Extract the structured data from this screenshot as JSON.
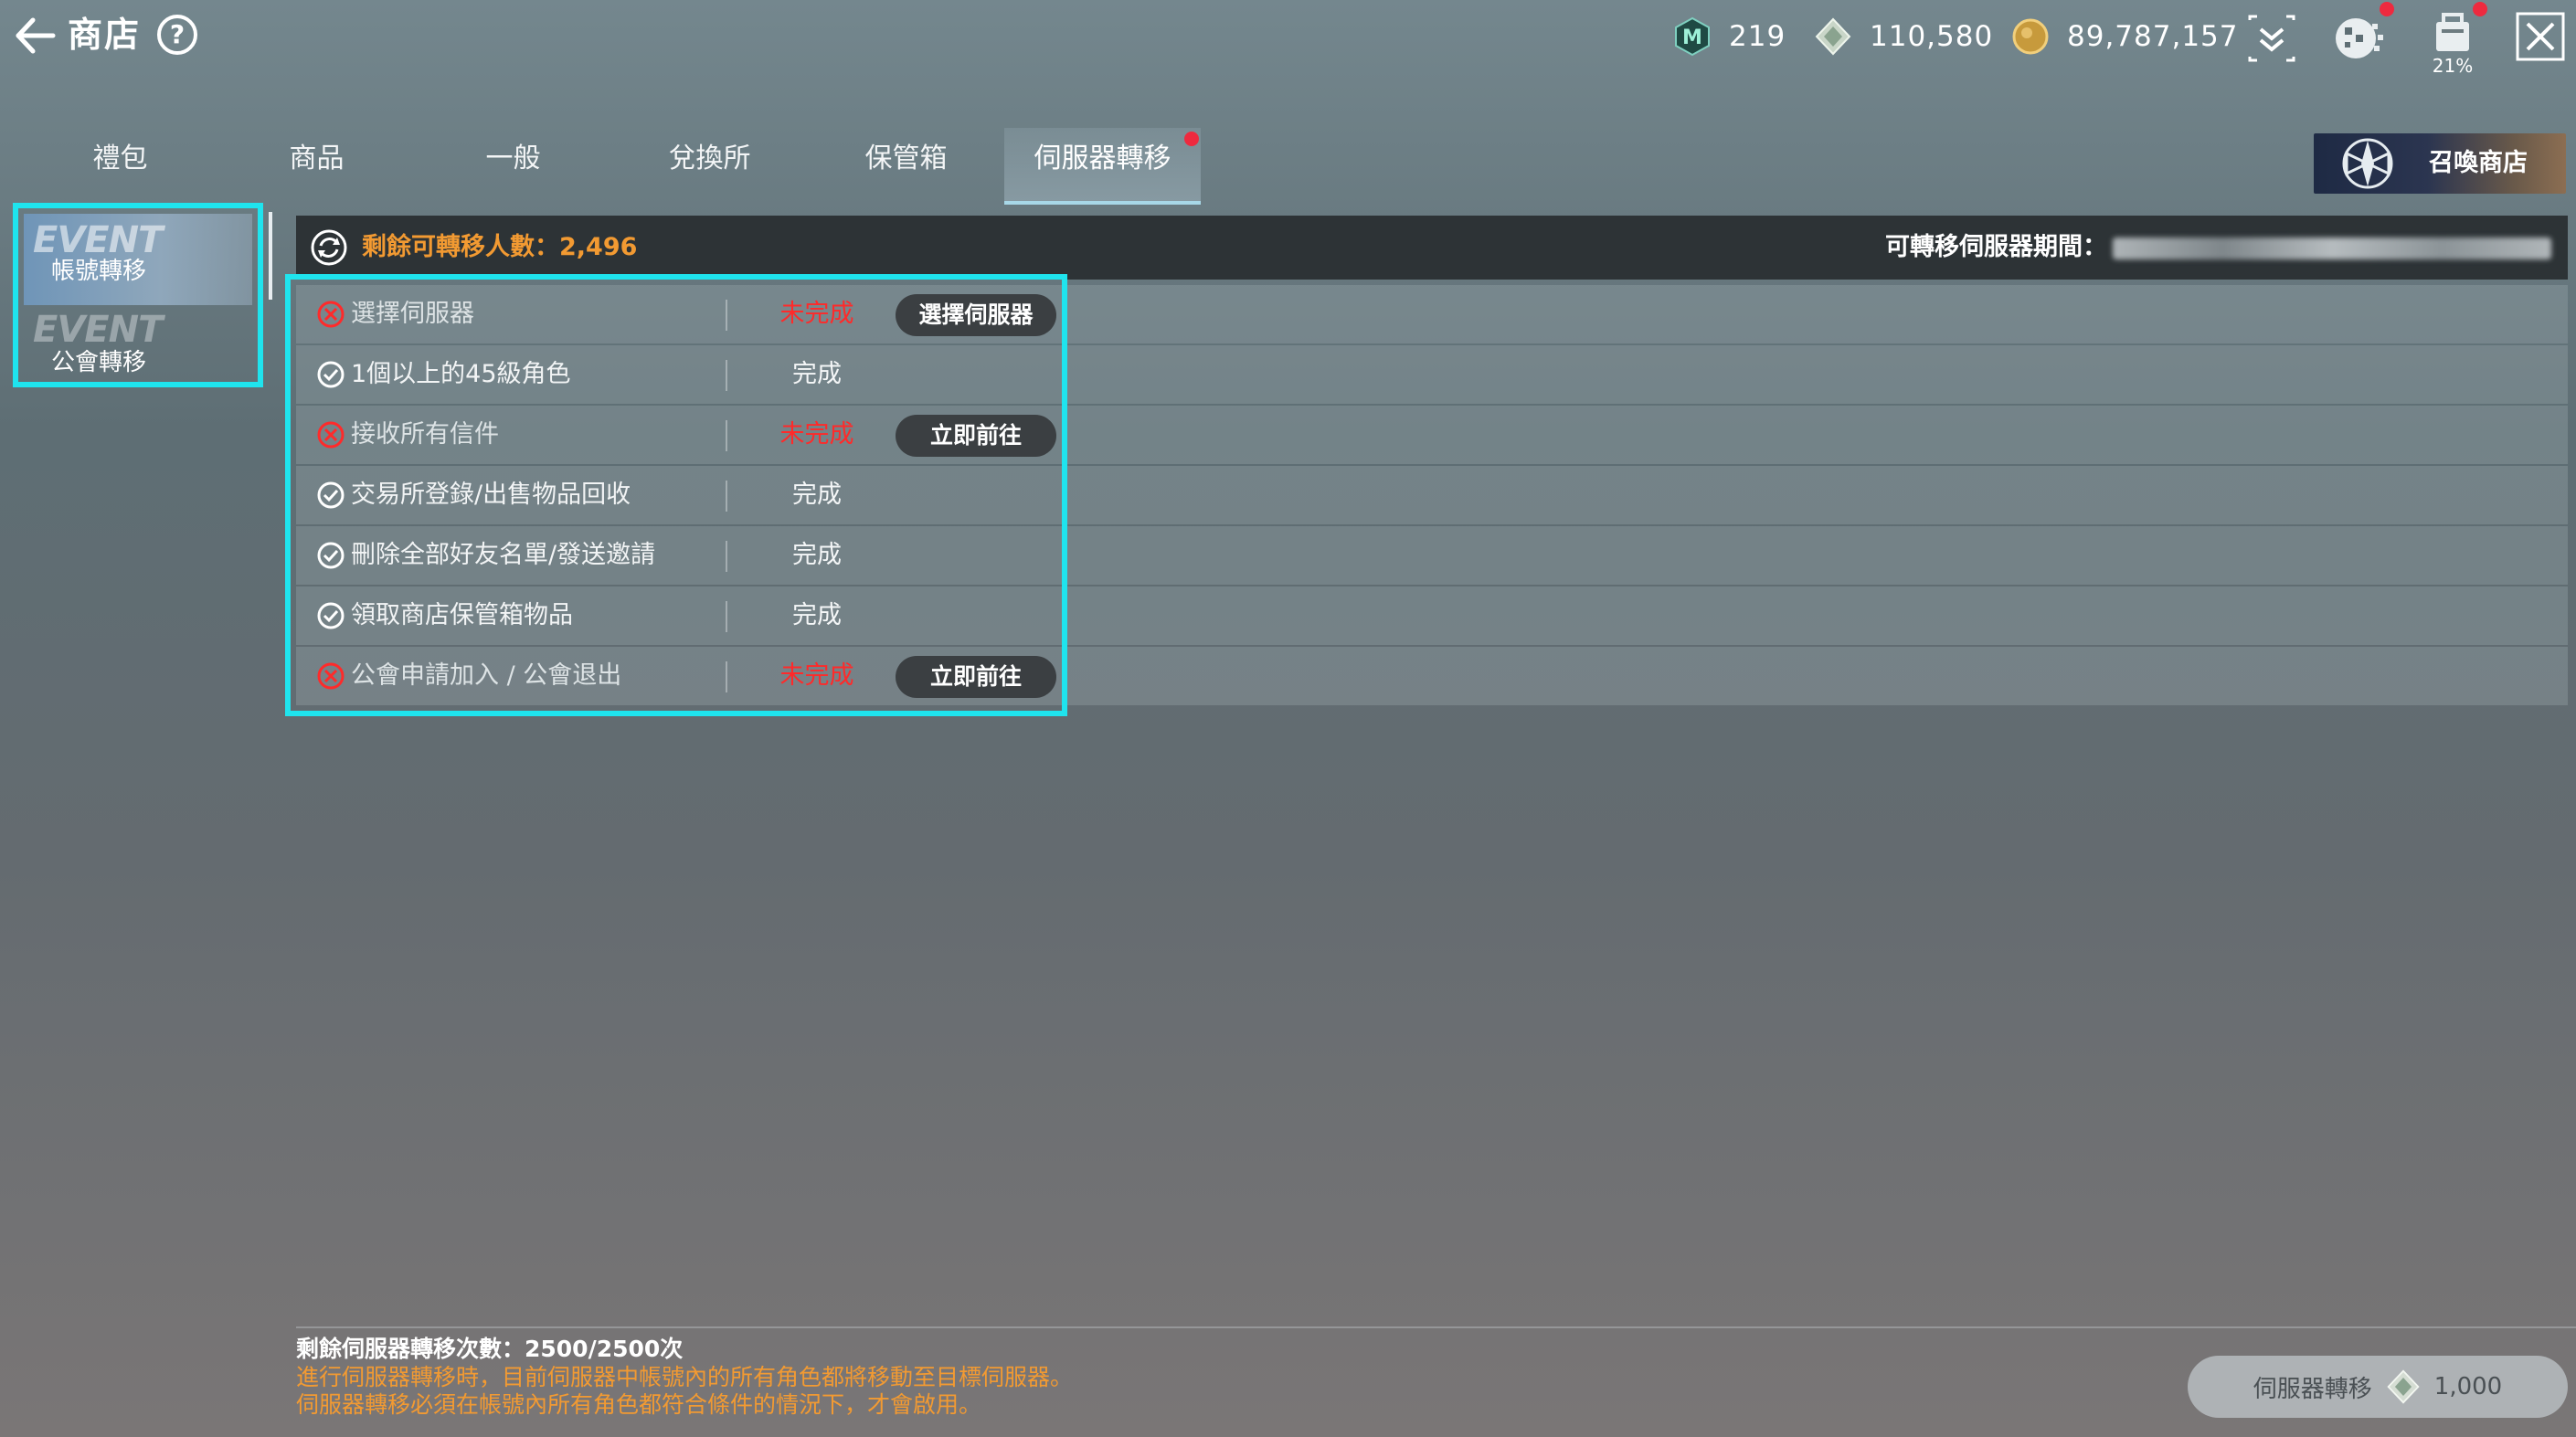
{
  "header": {
    "title": "商店",
    "help_icon": "?",
    "currencies": [
      {
        "icon": "mileage-coin-icon",
        "value": "219"
      },
      {
        "icon": "diamond-icon",
        "value": "110,580"
      },
      {
        "icon": "gold-coin-icon",
        "value": "89,787,157"
      }
    ],
    "inventory_percent": "21%"
  },
  "tabs": [
    {
      "label": "禮包"
    },
    {
      "label": "商品"
    },
    {
      "label": "一般"
    },
    {
      "label": "兌換所"
    },
    {
      "label": "保管箱"
    },
    {
      "label": "伺服器轉移",
      "active": true,
      "has_notification": true
    }
  ],
  "summon_shop": {
    "label": "召喚商店"
  },
  "sidenav": {
    "items": [
      {
        "event": "EVENT",
        "label": "帳號轉移",
        "active": true
      },
      {
        "event": "EVENT",
        "label": "公會轉移",
        "active": false
      }
    ]
  },
  "info": {
    "remaining_label": "剩餘可轉移人數：2,496",
    "period_label": "可轉移伺服器期間："
  },
  "conditions": [
    {
      "text": "選擇伺服器",
      "status": "未完成",
      "done": false,
      "button": "選擇伺服器"
    },
    {
      "text": "1個以上的45級角色",
      "status": "完成",
      "done": true,
      "button": ""
    },
    {
      "text": "接收所有信件",
      "status": "未完成",
      "done": false,
      "button": "立即前往"
    },
    {
      "text": "交易所登錄/出售物品回收",
      "status": "完成",
      "done": true,
      "button": ""
    },
    {
      "text": "刪除全部好友名單/發送邀請",
      "status": "完成",
      "done": true,
      "button": ""
    },
    {
      "text": "領取商店保管箱物品",
      "status": "完成",
      "done": true,
      "button": ""
    },
    {
      "text": "公會申請加入 / 公會退出",
      "status": "未完成",
      "done": false,
      "button": "立即前往"
    }
  ],
  "footer": {
    "count": "剩餘伺服器轉移次數：2500/2500次",
    "note1": "進行伺服器轉移時，目前伺服器中帳號內的所有角色都將移動至目標伺服器。",
    "note2": "伺服器轉移必須在帳號內所有角色都符合條件的情況下，才會啟用。",
    "transfer_label": "伺服器轉移",
    "transfer_cost": "1,000"
  },
  "colors": {
    "highlight": "#1fe4ee",
    "orange": "#f29a32",
    "incomplete_red": "#ff2a2a"
  }
}
